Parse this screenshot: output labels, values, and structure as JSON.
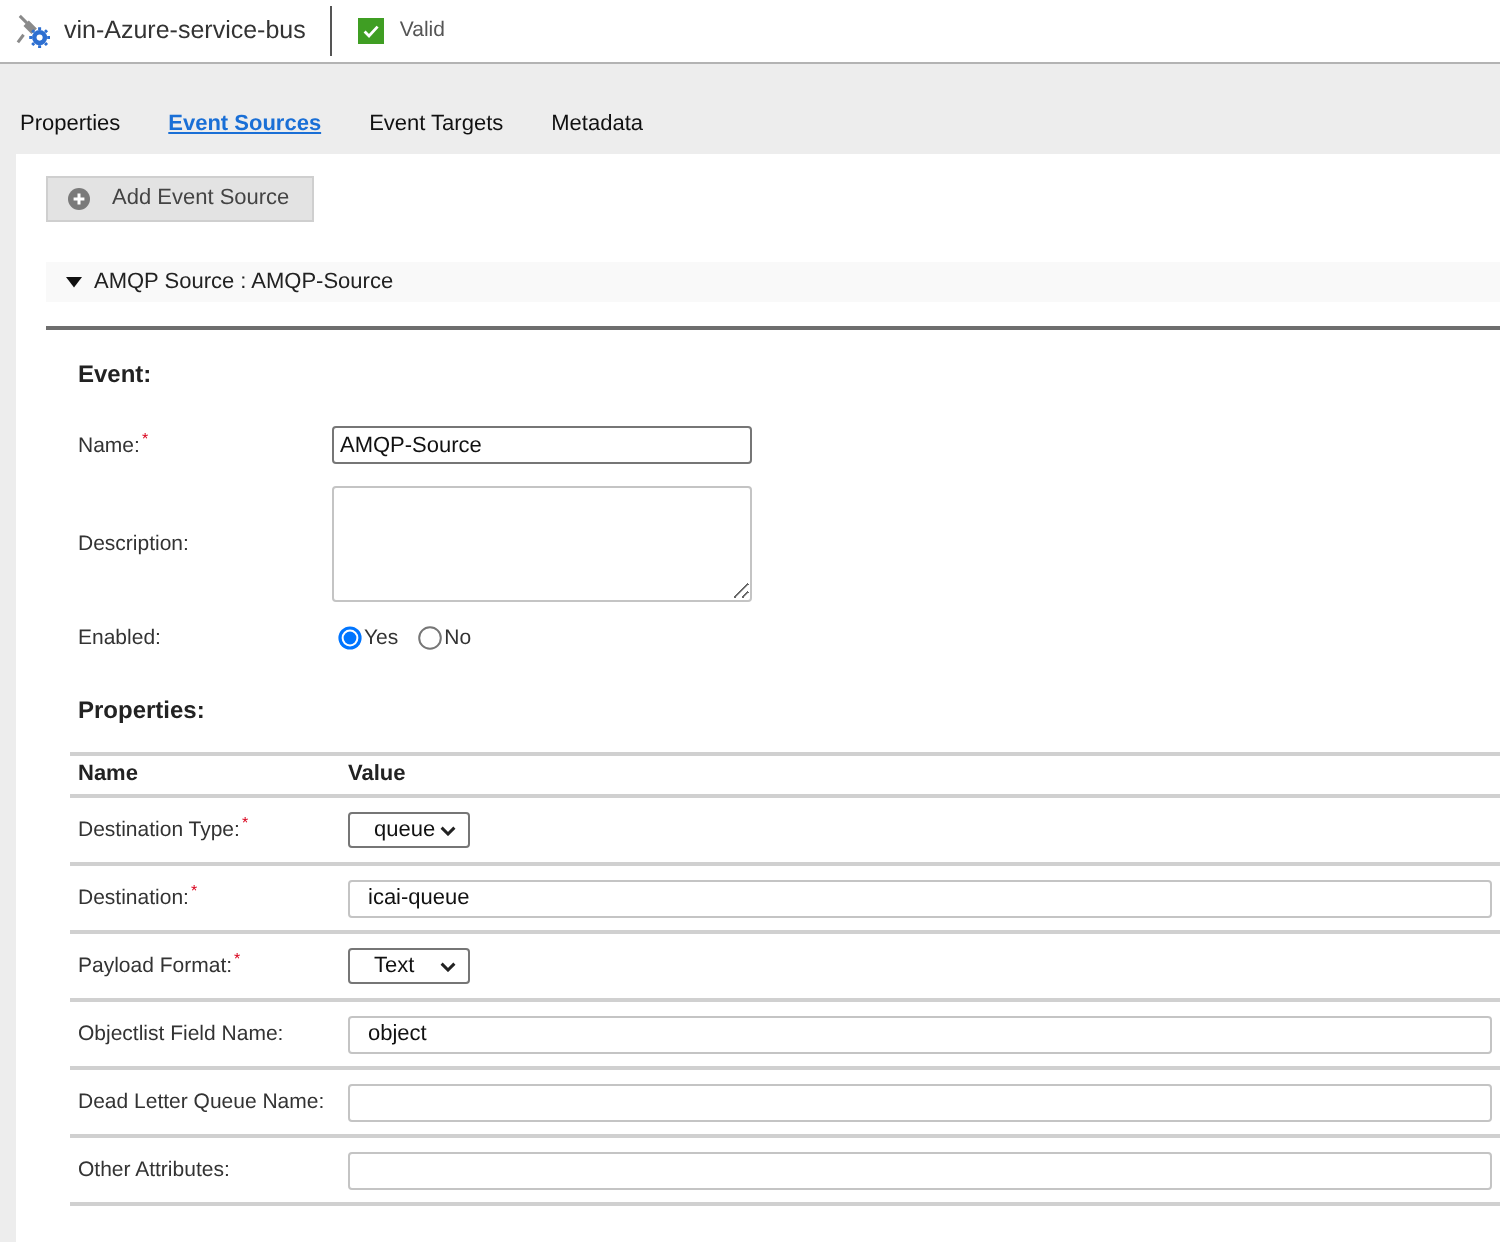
{
  "header": {
    "title": "vin-Azure-service-bus",
    "status": "Valid"
  },
  "tabs": [
    {
      "label": "Properties",
      "selected": false
    },
    {
      "label": "Event Sources",
      "selected": true
    },
    {
      "label": "Event Targets",
      "selected": false
    },
    {
      "label": "Metadata",
      "selected": false
    }
  ],
  "add_button": "Add Event Source",
  "section": {
    "title": "AMQP Source : AMQP-Source",
    "expanded": true
  },
  "event": {
    "heading": "Event:",
    "fields": [
      {
        "kind": "text",
        "label": "Name:$^{*}$",
        "value": "AMQP-Source"
      },
      {
        "kind": "textarea",
        "label": "Description:"
      },
      {
        "kind": "radio",
        "label": "Enabled:",
        "options": [
          {
            "label": "Yes",
            "selected": true
          },
          {
            "label": "No",
            "selected": false
          }
        ]
      }
    ]
  },
  "properties": {
    "heading": "Properties:",
    "columns": [
      "Name",
      "Value"
    ],
    "rows": [
      {
        "kind": "select",
        "label": "Destination Type:$^{*}$",
        "value": "queue"
      },
      {
        "kind": "text",
        "label": "Destination:$^{*}$",
        "value": "icai-queue"
      },
      {
        "kind": "select",
        "label": "Payload Format:$^{*}$",
        "value": "Text"
      },
      {
        "kind": "text",
        "label": "Objectlist Field Name:",
        "value": "object"
      },
      {
        "kind": "text",
        "label": "Dead Letter Queue Name:"
      },
      {
        "kind": "text",
        "label": "Other Attributes:"
      }
    ]
  }
}
